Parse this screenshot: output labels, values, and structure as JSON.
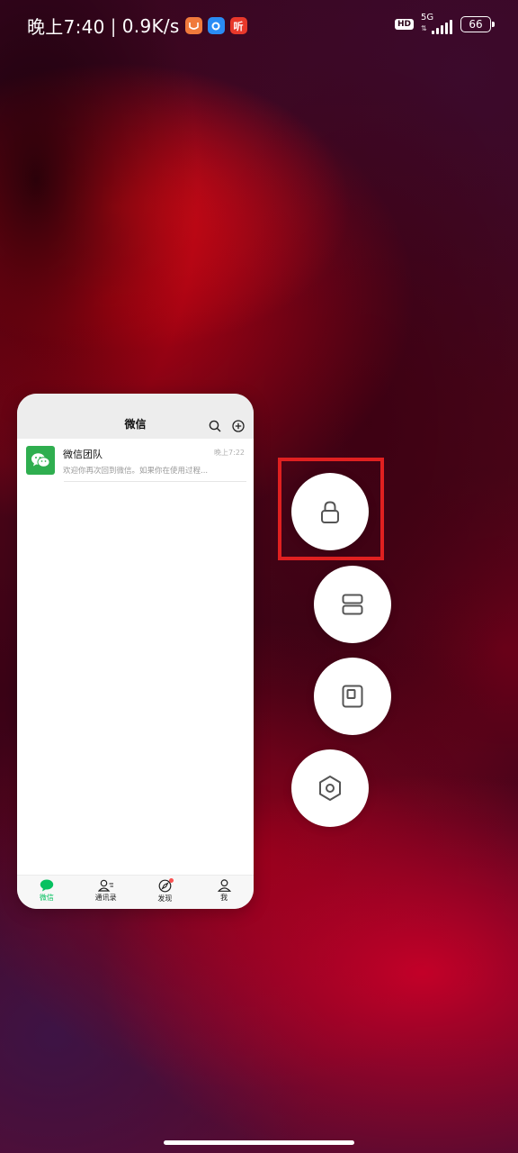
{
  "status_bar": {
    "time": "晚上7:40",
    "separator": "|",
    "net_speed": "0.9K/s",
    "app_icons": [
      {
        "name": "orange-app-icon",
        "glyph": "⌣",
        "color": "#f07a3c"
      },
      {
        "name": "blue-app-icon",
        "glyph": "●",
        "color": "#2a8cf5"
      },
      {
        "name": "red-listen-app-icon",
        "glyph": "听",
        "color": "#e8382b"
      }
    ],
    "hd": "HD",
    "network": "5G",
    "battery": "66"
  },
  "recent_app": {
    "title": "微信",
    "chat": {
      "name": "微信团队",
      "time": "晚上7:22",
      "preview": "欢迎你再次回到微信。如果你在使用过程..."
    },
    "tabs": [
      {
        "label": "微信",
        "icon": "chat-bubble-icon",
        "active": true
      },
      {
        "label": "通讯录",
        "icon": "contacts-icon",
        "active": false
      },
      {
        "label": "发现",
        "icon": "compass-icon",
        "active": false,
        "badge": true
      },
      {
        "label": "我",
        "icon": "person-icon",
        "active": false
      }
    ],
    "accent_color": "#07c160"
  },
  "actions": [
    {
      "name": "lock-app",
      "icon": "lock-icon",
      "highlighted": true
    },
    {
      "name": "split-screen",
      "icon": "split-screen-icon"
    },
    {
      "name": "small-window",
      "icon": "small-window-icon"
    },
    {
      "name": "app-settings",
      "icon": "hexagon-settings-icon"
    }
  ],
  "highlight_color": "#e02020"
}
